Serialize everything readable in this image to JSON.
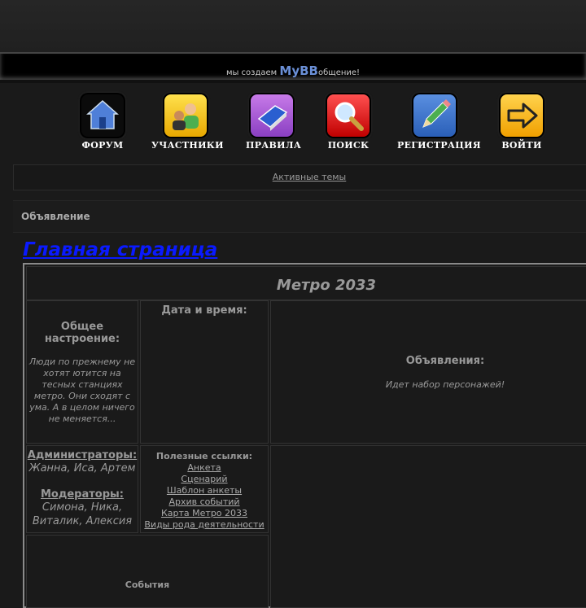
{
  "banner": {
    "prefix": "мы создаем",
    "brand": "MyBB",
    "suffix": "общение!"
  },
  "nav": [
    {
      "label": "ФОРУМ",
      "icon": "home-icon"
    },
    {
      "label": "УЧАСТНИКИ",
      "icon": "users-icon"
    },
    {
      "label": "ПРАВИЛА",
      "icon": "book-icon"
    },
    {
      "label": "ПОИСК",
      "icon": "search-icon"
    },
    {
      "label": "РЕГИСТРАЦИЯ",
      "icon": "pencil-icon"
    },
    {
      "label": "ВОЙТИ",
      "icon": "login-arrow-icon"
    }
  ],
  "active_topics": "Активные темы",
  "announcement": "Объявление",
  "main_link": "Главная страница",
  "table": {
    "title": "Метро 2033",
    "mood_title": "Общее настроение:",
    "mood_text": "Люди по прежнему не хотят ютится на тесных станциях метро. Они сходят с ума. А в целом ничего не меняется...",
    "datetime_title": "Дата и время:",
    "ads_title": "Объявления:",
    "ads_text": "Идет набор персонажей!",
    "admins_title": "Администраторы:",
    "admins": "Жанна, Иса, Артем",
    "mods_title": "Модераторы:",
    "mods_line1": "Симона, Ника,",
    "mods_line2": "Виталик, Алексия",
    "links_title": "Полезные ссылки:",
    "links": [
      "Анкета",
      "Сценарий",
      "Шаблон анкеты",
      "Архив событий",
      "Карта Метро 2033",
      "Виды рода деятельности"
    ],
    "events_title": "События"
  }
}
